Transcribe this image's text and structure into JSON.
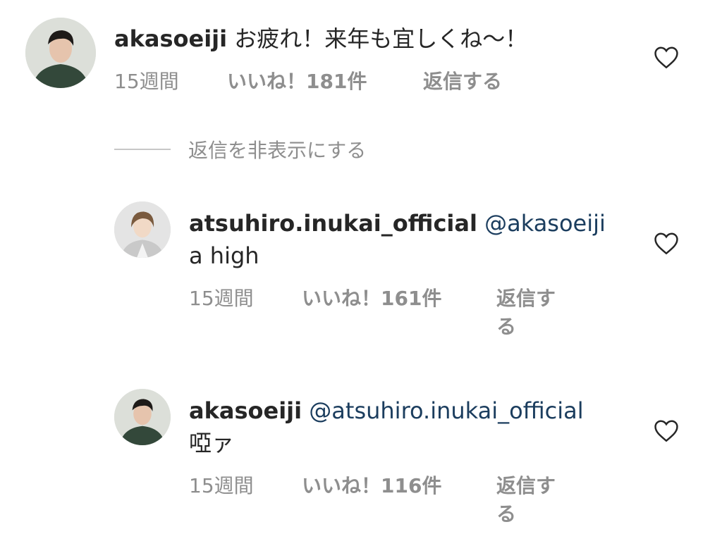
{
  "comments": [
    {
      "username": "akasoeiji",
      "text": "お疲れ！来年も宜しくね〜！",
      "time": "15週間",
      "likes": "いいね！181件",
      "reply": "返信する"
    },
    {
      "username": "atsuhiro.inukai_official",
      "mention": "@akasoeiji",
      "text": "a high",
      "time": "15週間",
      "likes": "いいね！161件",
      "reply": "返信する"
    },
    {
      "username": "akasoeiji",
      "mention": "@atsuhiro.inukai_official",
      "text": "啞ァ",
      "time": "15週間",
      "likes": "いいね！116件",
      "reply": "返信する"
    }
  ],
  "hide_replies": "返信を非表示にする",
  "colors": {
    "text": "#262626",
    "meta": "#8e8e8e",
    "mention": "#1b3d5e"
  }
}
